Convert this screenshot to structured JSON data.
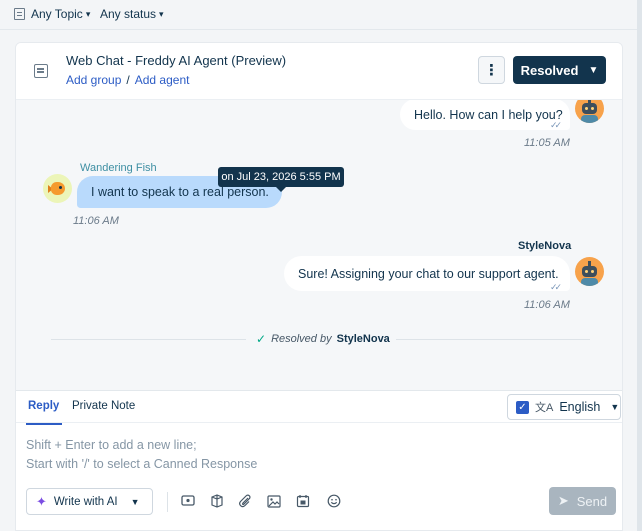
{
  "filters": {
    "topic": "Any Topic",
    "status": "Any status"
  },
  "header": {
    "title": "Web Chat - Freddy AI Agent (Preview)",
    "add_group": "Add group",
    "separator": "/",
    "add_agent": "Add agent",
    "more_label": "⋮",
    "status_button": "Resolved"
  },
  "messages": [
    {
      "side": "out",
      "text": "Hello. How can I help you?",
      "time": "11:05 AM"
    },
    {
      "side": "in",
      "sender": "Wandering Fish",
      "text": "I want to speak to a real person.",
      "time": "11:06 AM"
    },
    {
      "side": "out",
      "sender": "StyleNova",
      "text": "Sure! Assigning your chat to our support agent.",
      "time": "11:06 AM"
    }
  ],
  "tooltip": "on Jul 23, 2026 5:55 PM",
  "resolution": {
    "label": "Resolved by",
    "agent": "StyleNova"
  },
  "composer": {
    "tabs": {
      "reply": "Reply",
      "private_note": "Private Note"
    },
    "language": "English",
    "placeholder_line1": "Shift + Enter to add a new line;",
    "placeholder_line2": "Start with '/' to select a Canned Response",
    "ai_button": "Write with AI",
    "send_button": "Send"
  },
  "icons": {
    "check": "✓",
    "chevron": "⌄",
    "translate": "文A",
    "sparkle": "✦",
    "send": "➤"
  },
  "colors": {
    "primary_dark": "#12344d",
    "link_blue": "#2c5cc5",
    "user_bubble": "#b9dafc",
    "agent_bubble": "#ffffff",
    "resolved_check": "#00a886",
    "bot_avatar": "#f7a24b",
    "send_disabled": "#a9b5bf"
  }
}
